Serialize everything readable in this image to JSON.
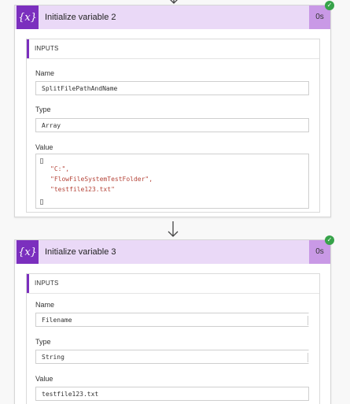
{
  "colors": {
    "accent": "#7b2fbe",
    "header_bg": "#ead9f7",
    "duration_bg": "#c999e6",
    "success": "#37a34a",
    "string_value": "#b5453a"
  },
  "cards": [
    {
      "icon": "{x}",
      "title": "Initialize variable 2",
      "duration": "0s",
      "status_icon": "check-icon",
      "inputs_label": "INPUTS",
      "fields": {
        "name_label": "Name",
        "name_value": "SplitFilePathAndName",
        "type_label": "Type",
        "type_value": "Array",
        "value_label": "Value",
        "value_items": [
          "\"C:\",",
          "\"FlowFileSystemTestFolder\",",
          "\"testfile123.txt\""
        ]
      }
    },
    {
      "icon": "{x}",
      "title": "Initialize variable 3",
      "duration": "0s",
      "status_icon": "check-icon",
      "inputs_label": "INPUTS",
      "fields": {
        "name_label": "Name",
        "name_value": "Filename",
        "type_label": "Type",
        "type_value": "String",
        "value_label": "Value",
        "value_value": "testfile123.txt"
      }
    }
  ]
}
